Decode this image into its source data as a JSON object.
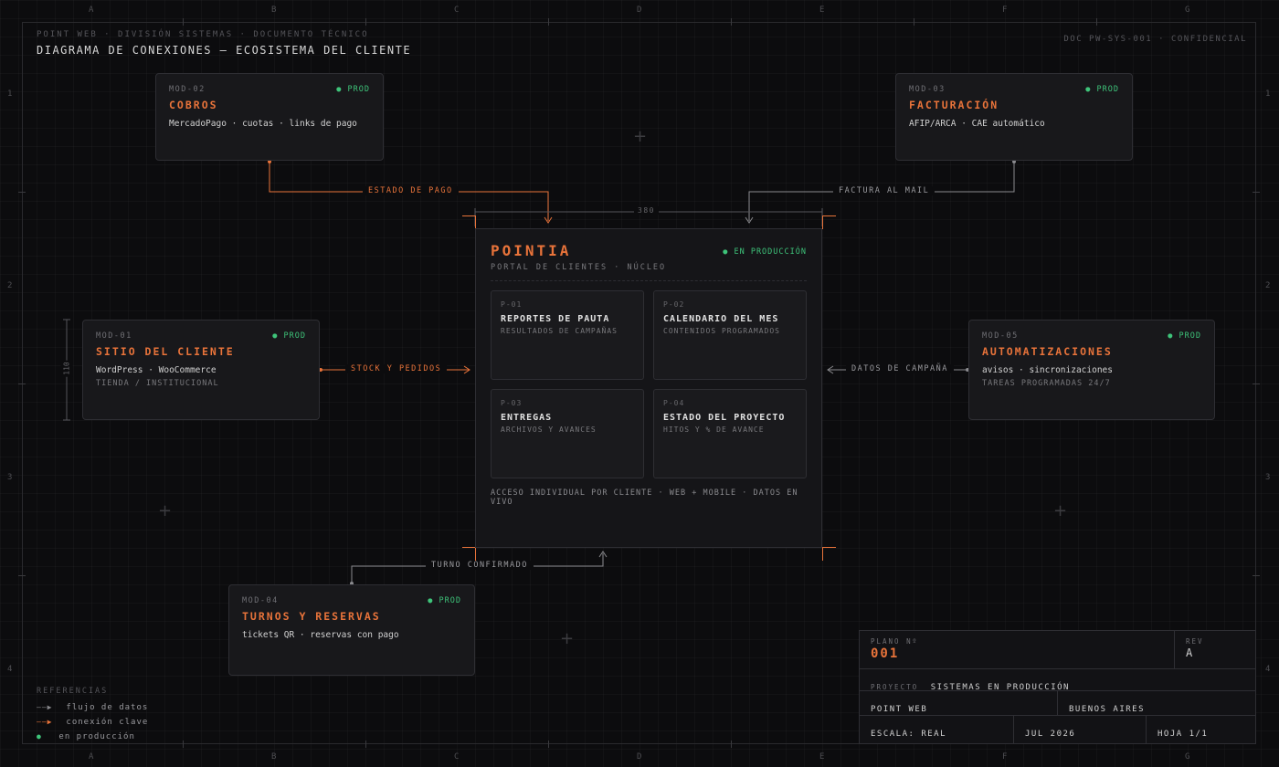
{
  "header": {
    "super": "POINT WEB · DIVISIÓN SISTEMAS · DOCUMENTO TÉCNICO",
    "title": "DIAGRAMA DE CONEXIONES — ECOSISTEMA DEL CLIENTE",
    "doc": "DOC PW-SYS-001 · CONFIDENCIAL"
  },
  "grid": {
    "columns": [
      "A",
      "B",
      "C",
      "D",
      "E",
      "F",
      "G"
    ],
    "rows": [
      "1",
      "2",
      "3",
      "4"
    ]
  },
  "modules": {
    "cobros": {
      "code": "MOD-02",
      "status": "● PROD",
      "title": "COBROS",
      "desc": "MercadoPago · cuotas · links de pago",
      "sub": ""
    },
    "facturacion": {
      "code": "MOD-03",
      "status": "● PROD",
      "title": "FACTURACIÓN",
      "desc": "AFIP/ARCA · CAE automático",
      "sub": ""
    },
    "sitio": {
      "code": "MOD-01",
      "status": "● PROD",
      "title": "SITIO DEL CLIENTE",
      "desc": "WordPress · WooCommerce",
      "sub": "TIENDA / INSTITUCIONAL"
    },
    "automatizaciones": {
      "code": "MOD-05",
      "status": "● PROD",
      "title": "AUTOMATIZACIONES",
      "desc": "avisos · sincronizaciones",
      "sub": "TAREAS PROGRAMADAS 24/7"
    },
    "turnos": {
      "code": "MOD-04",
      "status": "● PROD",
      "title": "TURNOS Y RESERVAS",
      "desc": "tickets QR · reservas con pago",
      "sub": ""
    }
  },
  "core": {
    "title": "POINTIA",
    "subtitle": "PORTAL DE CLIENTES · NÚCLEO",
    "status": "● EN PRODUCCIÓN",
    "panels": [
      {
        "code": "P-01",
        "title": "REPORTES DE PAUTA",
        "sub": "RESULTADOS DE CAMPAÑAS"
      },
      {
        "code": "P-02",
        "title": "CALENDARIO DEL MES",
        "sub": "CONTENIDOS PROGRAMADOS"
      },
      {
        "code": "P-03",
        "title": "ENTREGAS",
        "sub": "ARCHIVOS Y AVANCES"
      },
      {
        "code": "P-04",
        "title": "ESTADO DEL PROYECTO",
        "sub": "HITOS Y % DE AVANCE"
      }
    ],
    "footer": "ACCESO INDIVIDUAL POR CLIENTE · WEB + MOBILE · DATOS EN VIVO"
  },
  "dimensions": {
    "width": "380",
    "height": "110"
  },
  "connections": {
    "estado_pago": "ESTADO DE PAGO",
    "factura_mail": "FACTURA AL MAIL",
    "stock_pedidos": "STOCK Y PEDIDOS",
    "datos_campana": "DATOS DE CAMPAÑA",
    "turno_confirmado": "TURNO CONFIRMADO"
  },
  "title_block": {
    "plano_label": "PLANO Nº",
    "plano_value": "001",
    "rev_label": "REV",
    "rev_value": "A",
    "proyecto_label": "PROYECTO",
    "proyecto_value": "SISTEMAS EN PRODUCCIÓN",
    "company": "POINT WEB",
    "city": "BUENOS AIRES",
    "escala": "ESCALA: REAL",
    "fecha": "JUL 2026",
    "hoja": "HOJA 1/1"
  },
  "legend": {
    "title": "REFERENCIAS",
    "items": [
      {
        "symbol": "——▶",
        "label": "flujo de datos"
      },
      {
        "symbol": "——▶",
        "label": "conexión clave"
      },
      {
        "symbol": "●",
        "label": "en producción"
      }
    ]
  },
  "colors": {
    "accent": "#e8733a",
    "status_green": "#3ec47a",
    "grey_line": "#8a8a8e"
  }
}
